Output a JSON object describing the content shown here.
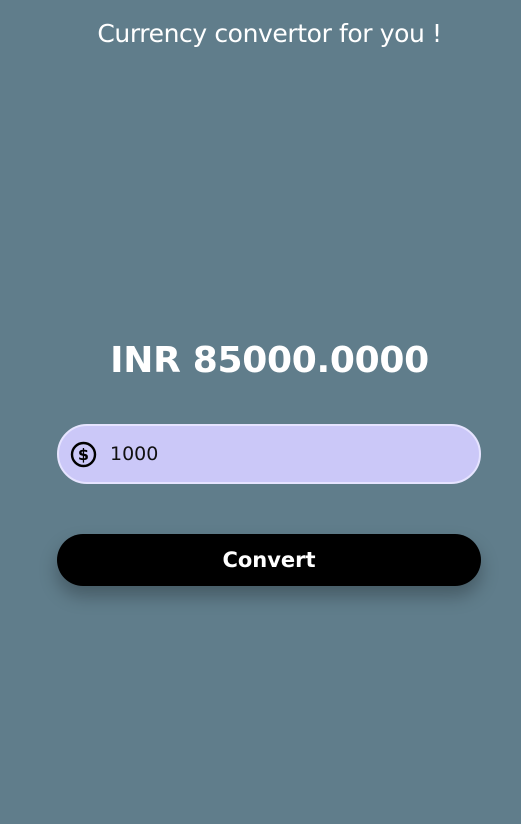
{
  "app": {
    "title": "Currency convertor for you !"
  },
  "result": {
    "text": "INR 85000.0000"
  },
  "amount_field": {
    "value": "1000",
    "icon": "dollar-circle-icon"
  },
  "convert_button": {
    "label": "Convert"
  },
  "colors": {
    "background": "#607d8b",
    "field_fill": "#cbc8f8",
    "button_fill": "#000000",
    "text_light": "#ffffff"
  }
}
